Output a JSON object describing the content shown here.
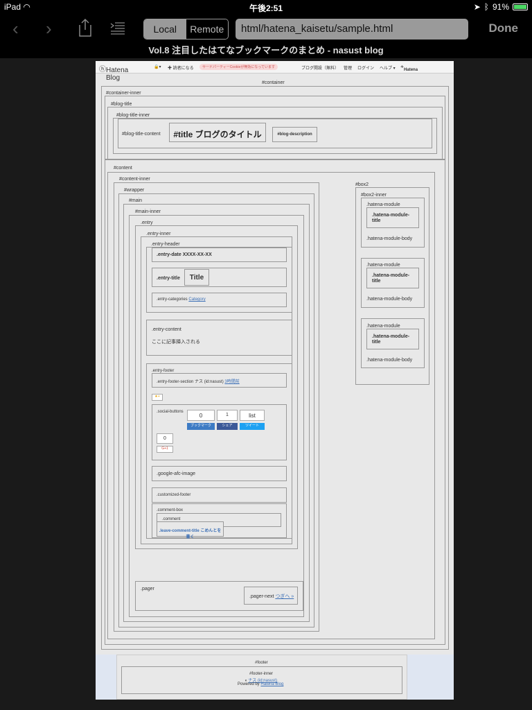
{
  "status": {
    "device": "iPad",
    "time": "午後2:51",
    "battery": "91%"
  },
  "toolbar": {
    "local": "Local",
    "remote": "Remote",
    "url": "html/hatena_kaisetu/sample.html",
    "done": "Done"
  },
  "page_title": "Vol.8 注目したはてなブックマークのまとめ - nasust blog",
  "header": {
    "logo": "Hatena Blog",
    "reader": "✚ 読者になる",
    "cookie": "サードパーティーCookieが無効になっています",
    "blog_open": "ブログ開設（無料）",
    "admin": "管理",
    "login": "ログイン",
    "help": "ヘルプ ▾",
    "hatena": "Hatena"
  },
  "labels": {
    "container": "#container",
    "container_inner": "#container-inner",
    "blog_title": "#blog-title",
    "blog_title_inner": "#blog-title-inner",
    "blog_title_content": "#blog-title-content",
    "title": "#title ブログのタイトル",
    "blog_description": "#blog-description",
    "content": "#content",
    "content_inner": "#content-inner",
    "wrapper": "#wrapper",
    "main": "#main",
    "main_inner": "#main-inner",
    "entry": ".entry",
    "entry_inner": ".entry-inner",
    "entry_header": ".entry-header",
    "entry_date": ".entry-date XXXX-XX-XX",
    "entry_title": ".entry-title",
    "title_word": "Title",
    "entry_categories": ".entry-categories",
    "category": "Category",
    "entry_content": ".entry-content",
    "content_text": "ここに記事挿入される",
    "entry_footer": ".entry-footer",
    "entry_footer_section": ".entry-footer-section ナス (id:nasust)",
    "time_ago": "3時間前",
    "star": "★+",
    "social_buttons": ".social-buttons",
    "count_bookmark": "0",
    "count_facebook": "1",
    "list": "list",
    "bookmark": "ブックマーク",
    "share": "シェア",
    "tweet": "ツイート",
    "gplus_count": "0",
    "gplus": "G+1",
    "google_afc": ".google-afc-image",
    "customized_footer": ".customized-footer",
    "comment_box": ".comment-box",
    "comment": ".comment",
    "leave_comment": ".leave-comment-title こめんとを書く",
    "pager": ".pager",
    "pager_next": ".pager-next",
    "next_link": "つぎへ »",
    "box2": "#box2",
    "box2_inner": "#box2-inner",
    "hatena_module": ".hatena-module",
    "hatena_module_title": ".hatena-module-title",
    "hatena_module_body": ".hatena-module-body",
    "footer": "#footer",
    "footer_inner": "#footer-inner",
    "footer_author": "ナス (id:nasust)",
    "powered_by": "Powered by",
    "hatena_blog": "Hatena Blog"
  }
}
